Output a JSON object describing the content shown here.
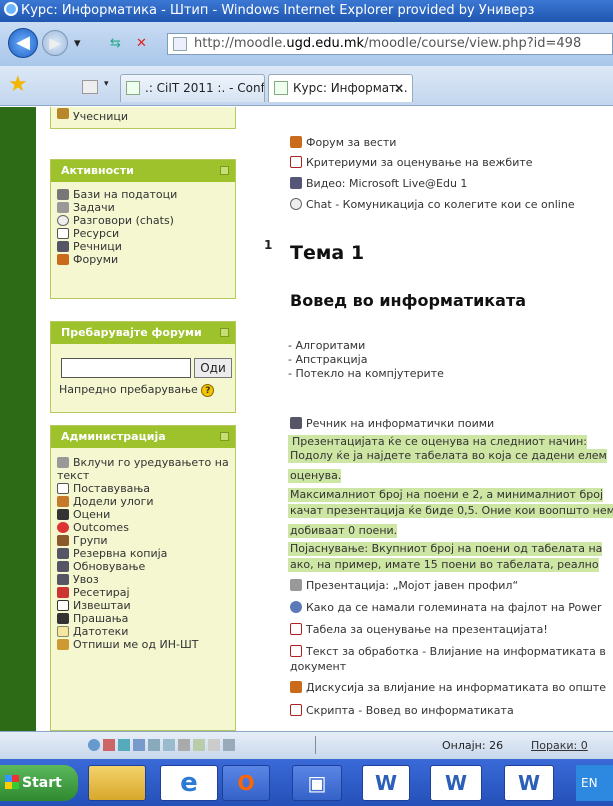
{
  "window": {
    "title": "Курс: Информатика - Штип - Windows Internet Explorer provided by Универз"
  },
  "address": {
    "prefix": "http://moodle.",
    "domain": "ugd.edu.mk",
    "path": "/moodle/course/view.php?id=498"
  },
  "tabs": [
    {
      "label": ".: CiIT 2011 :. - Conf..."
    },
    {
      "label": "Курс: Информат...",
      "close": "×"
    }
  ],
  "sidebar": {
    "top_partial": "Учесници",
    "activities": {
      "title": "Активности",
      "items": [
        "Бази на податоци",
        "Задачи",
        "Разговори (chats)",
        "Ресурси",
        "Речници",
        "Форуми"
      ]
    },
    "search": {
      "title": "Пребарувајте форуми",
      "button": "Оди",
      "advanced": "Напредно пребарување"
    },
    "admin": {
      "title": "Администрација",
      "items": [
        "Вклучи го уредувањето на",
        "текст",
        "Поставувања",
        "Додели улоги",
        "Оцени",
        "Outcomes",
        "Групи",
        "Резервна копија",
        "Обновување",
        "Увоз",
        "Ресетирај",
        "Извештаи",
        "Прашања",
        "Датотеки",
        "Отпиши ме од ИН-ШТ"
      ]
    }
  },
  "content": {
    "top_links": [
      "Форум за вести",
      "Критериуми за оценување на вежбите",
      "Видео: Microsoft Live@Edu 1",
      "Chat - Комуникација со колегите кои се online"
    ],
    "section_number": "1",
    "topic_title": "Тема 1",
    "topic_subtitle": "Вовед во информатиката",
    "bullets": [
      "- Алгоритами",
      "- Апстракција",
      "- Потекло на компјутерите"
    ],
    "glossary": "Речник на информатички поими",
    "highlight": [
      "Презентацијата ќе се оценува на следниот начин:",
      "Подолу ќе ја најдете табелата во која се дадени елем",
      "оценува.",
      "Максималниот број на поени е 2, а минималниот број",
      "качат презентација ќе биде 0,5. Оние кои воопшто нем",
      "добиваат 0 поени.",
      "Појаснување: Вкупниот број на поени од табелата на",
      "ако, на пример, имате 15 поени во табелата, реално"
    ],
    "links2": [
      "Презентација: „Мојот јавен профил“",
      "Како да се намали големината на фајлот на Power",
      "Табела за оценување на презентацијата!",
      "Текст за обработка - Влијание на информатиката в",
      "документ",
      "Дискусија за влијание на информатиката во опште",
      "Скрипта - Вовед во информатиката"
    ]
  },
  "status": {
    "online": "Онлајн: 26",
    "messages": "Пораки: 0"
  },
  "taskbar": {
    "start": "Start",
    "lang": "EN"
  }
}
